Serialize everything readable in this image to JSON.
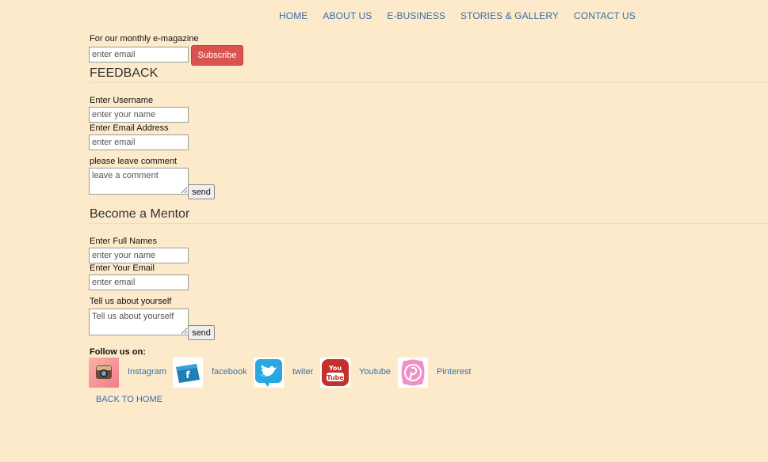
{
  "nav": [
    "HOME",
    "ABOUT US",
    "E-BUSINESS",
    "STORIES & GALLERY",
    "CONTACT US"
  ],
  "newsletter": {
    "label": "For our monthly e-magazine",
    "placeholder": "enter email",
    "button": "Subscribe"
  },
  "feedback": {
    "title": "FEEDBACK",
    "username_label": "Enter Username",
    "username_placeholder": "enter your name",
    "email_label": "Enter Email Address",
    "email_placeholder": "enter email",
    "comment_label": "please leave comment",
    "comment_placeholder": "leave a comment",
    "send": "send"
  },
  "mentor": {
    "title": "Become a Mentor",
    "name_label": "Enter Full Names",
    "name_placeholder": "enter your name",
    "email_label": "Enter Your Email",
    "email_placeholder": "enter email",
    "about_label": "Tell us about yourself",
    "about_placeholder": "Tell us about yourself",
    "send": "send"
  },
  "social": {
    "label": "Follow us on:",
    "links": [
      "Instagram",
      "facebook",
      "twiter",
      "Youtube",
      "Pinterest"
    ]
  },
  "back": "BACK TO HOME"
}
